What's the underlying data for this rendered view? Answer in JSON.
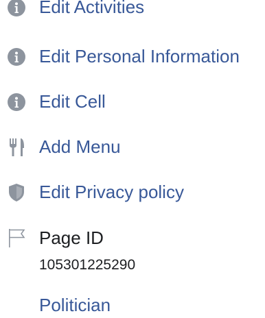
{
  "menu_items": [
    {
      "label": "Edit Activities",
      "icon": "info-icon"
    },
    {
      "label": "Edit Personal Information",
      "icon": "info-icon"
    },
    {
      "label": "Edit Cell",
      "icon": "info-icon"
    },
    {
      "label": "Add Menu",
      "icon": "fork-knife-icon"
    },
    {
      "label": "Edit Privacy policy",
      "icon": "shield-icon"
    }
  ],
  "page_id": {
    "label": "Page ID",
    "value": "105301225290",
    "icon": "flag-icon"
  },
  "category": {
    "label": "Politician"
  },
  "colors": {
    "link": "#385898",
    "text": "#1c1e21",
    "icon": "#8d949e"
  }
}
